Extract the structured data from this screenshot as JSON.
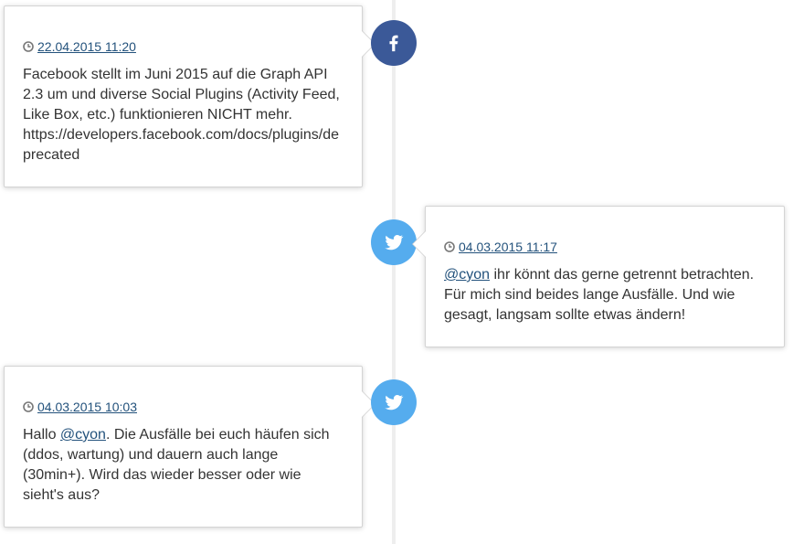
{
  "colors": {
    "facebook": "#3b5998",
    "twitter": "#55acee",
    "link": "#23527c",
    "line": "#eeeeee"
  },
  "posts": [
    {
      "network_icon": "facebook-icon",
      "date": "22.04.2015 11:20",
      "text": "Facebook stellt im Juni 2015 auf die Graph API 2.3 um und diverse Social Plugins (Activity Feed, Like Box, etc.) funktionieren NICHT mehr. https://developers.facebook.com/docs/plugins/deprecated"
    },
    {
      "network_icon": "twitter-icon",
      "date": "04.03.2015 11:17",
      "mention": "@cyon",
      "text": " ihr könnt das gerne getrennt betrachten. Für mich sind beides lange Ausfälle. Und wie gesagt, langsam sollte etwas ändern!"
    },
    {
      "network_icon": "twitter-icon",
      "date": "04.03.2015 10:03",
      "text_before": "Hallo ",
      "mention": "@cyon",
      "text": ". Die Ausfälle bei euch häufen sich (ddos, wartung) und dauern auch lange (30min+). Wird das wieder besser oder wie sieht's aus?"
    }
  ]
}
